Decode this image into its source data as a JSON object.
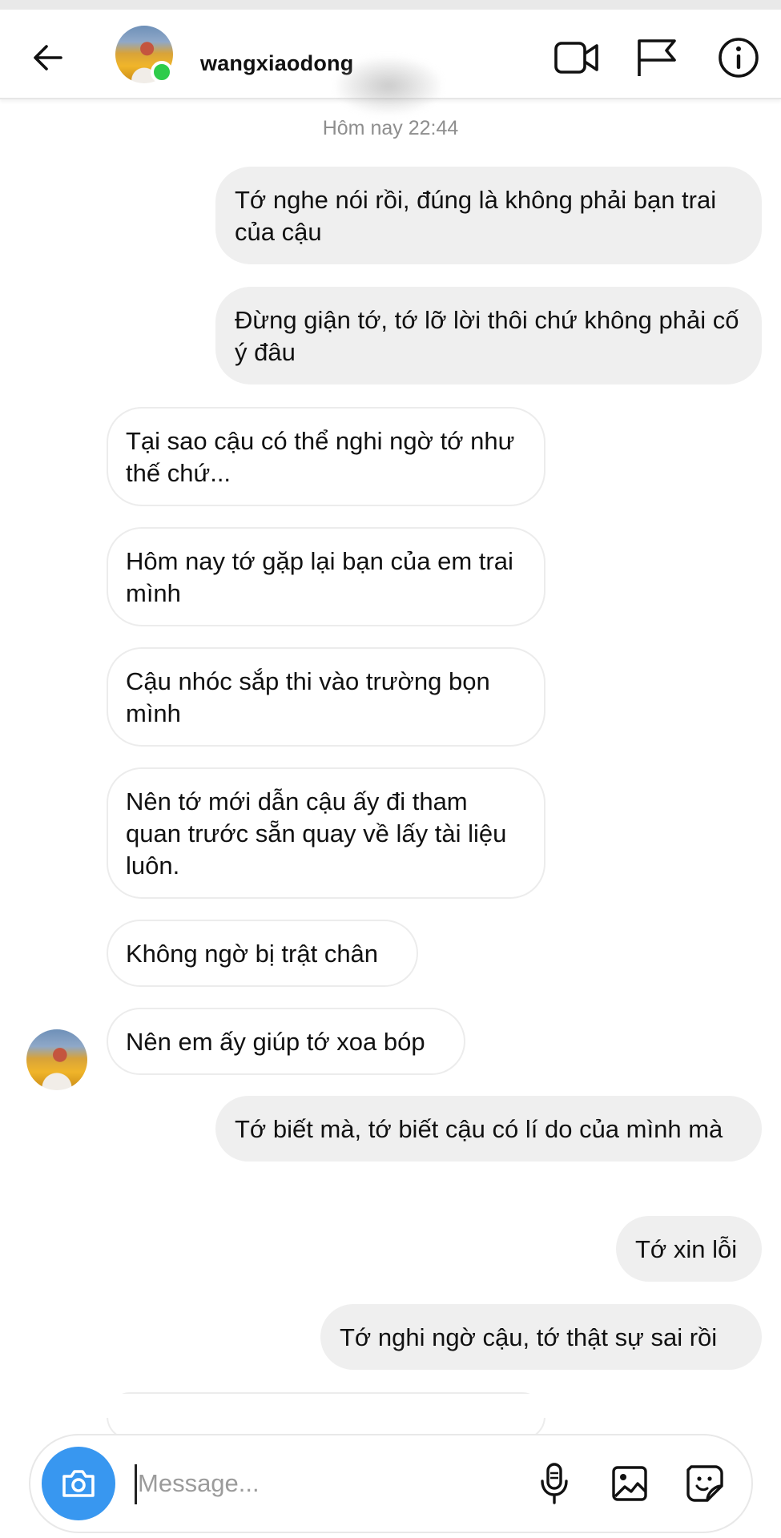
{
  "header": {
    "username": "wangxiaodong",
    "online": true,
    "icons": [
      "back-arrow-icon",
      "video-call-icon",
      "flag-icon",
      "info-icon"
    ]
  },
  "conversation": {
    "timestamp": "Hôm nay 22:44",
    "messages": [
      {
        "from": "me",
        "text": "Tớ nghe nói rồi, đúng là không phải bạn trai của cậu"
      },
      {
        "from": "me",
        "text": "Đừng giận tớ, tớ lỡ lời thôi chứ không phải cố ý đâu"
      },
      {
        "from": "them",
        "text": "Tại sao cậu có thể nghi ngờ tớ như thế chứ..."
      },
      {
        "from": "them",
        "text": "Hôm nay tớ gặp lại bạn của em trai mình"
      },
      {
        "from": "them",
        "text": "Cậu nhóc sắp thi vào trường bọn mình"
      },
      {
        "from": "them",
        "text": "Nên tớ mới dẫn cậu ấy đi tham quan trước sẵn quay về lấy tài liệu luôn."
      },
      {
        "from": "them",
        "text": "Không ngờ bị trật chân"
      },
      {
        "from": "them",
        "text": "Nên em ấy giúp tớ xoa bóp"
      },
      {
        "from": "me",
        "text": "Tớ biết mà, tớ biết cậu có lí do của mình mà"
      },
      {
        "from": "me",
        "text": "Tớ xin lỗi"
      },
      {
        "from": "me",
        "text": "Tớ nghi ngờ cậu, tớ thật sự sai rồi"
      }
    ]
  },
  "composer": {
    "placeholder": "Message...",
    "value": "",
    "icons": [
      "camera-icon",
      "microphone-icon",
      "gallery-icon",
      "sticker-icon"
    ]
  },
  "colors": {
    "accent": "#3897f0",
    "online": "#2ecc4a",
    "outgoing_bubble": "#efefef",
    "incoming_border": "#ececec",
    "timestamp": "#8e8e8e"
  }
}
